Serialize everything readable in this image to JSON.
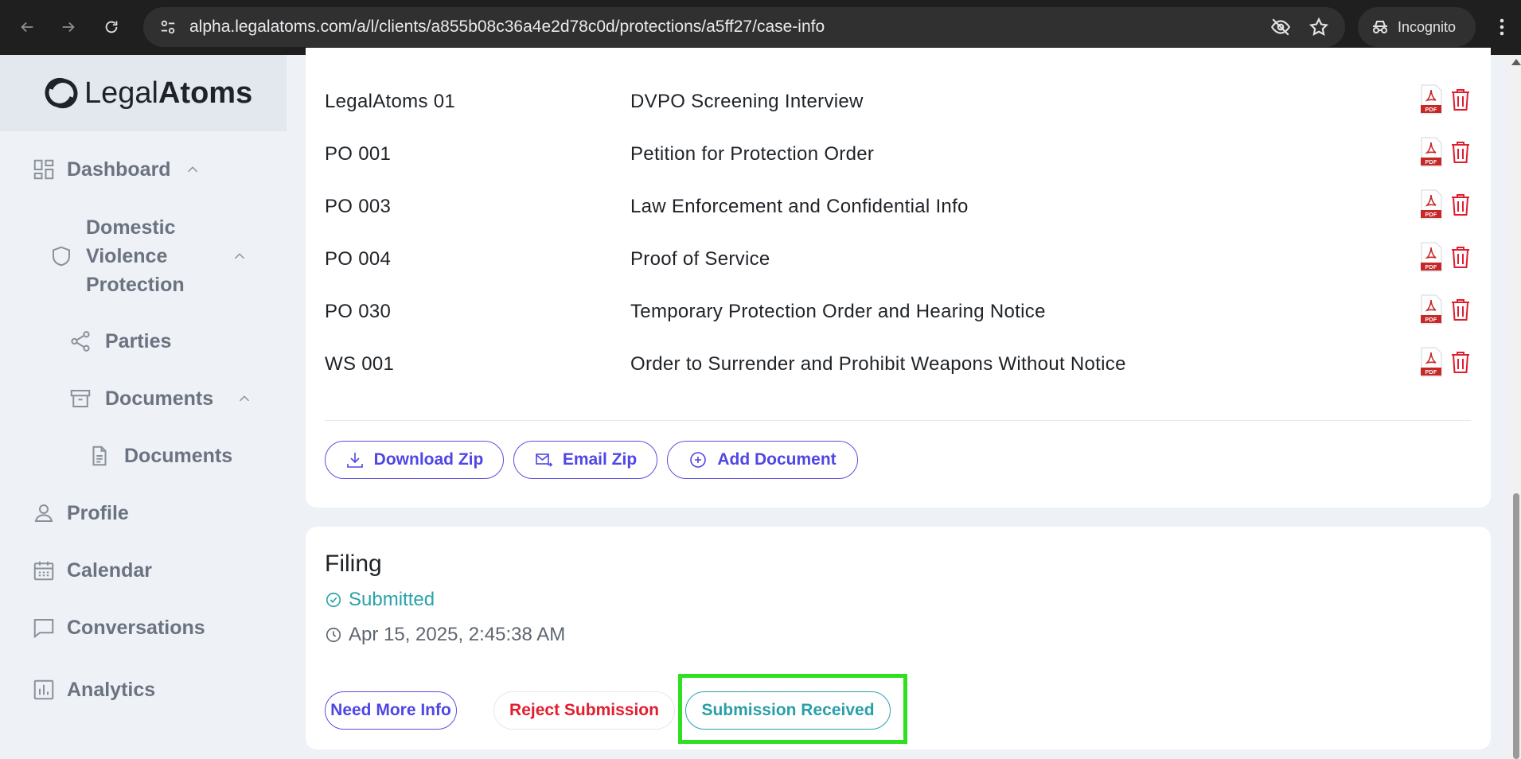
{
  "browser": {
    "url": "alpha.legalatoms.com/a/l/clients/a855b08c36a4e2d78c0d/protections/a5ff27/case-info",
    "incognito_label": "Incognito"
  },
  "brand": {
    "name_regular": "Legal",
    "name_bold": "Atoms"
  },
  "sidebar": {
    "dashboard": "Dashboard",
    "dvp_line1": "Domestic",
    "dvp_line2": "Violence",
    "dvp_line3": "Protection",
    "parties": "Parties",
    "documents_group": "Documents",
    "documents_item": "Documents",
    "profile": "Profile",
    "calendar": "Calendar",
    "conversations": "Conversations",
    "analytics": "Analytics"
  },
  "documents": {
    "rows": [
      {
        "code": "LegalAtoms 01",
        "name": "DVPO Screening Interview"
      },
      {
        "code": "PO 001",
        "name": "Petition for Protection Order"
      },
      {
        "code": "PO 003",
        "name": "Law Enforcement and Confidential Info"
      },
      {
        "code": "PO 004",
        "name": "Proof of Service"
      },
      {
        "code": "PO 030",
        "name": "Temporary Protection Order and Hearing Notice"
      },
      {
        "code": "WS 001",
        "name": "Order to Surrender and Prohibit Weapons Without Notice"
      }
    ],
    "download_zip": "Download Zip",
    "email_zip": "Email Zip",
    "add_document": "Add Document"
  },
  "filing": {
    "title": "Filing",
    "status": "Submitted",
    "timestamp": "Apr 15, 2025, 2:45:38 AM",
    "need_more_info": "Need More Info",
    "reject_submission": "Reject Submission",
    "submission_received": "Submission Received"
  },
  "colors": {
    "accent": "#4f46e5",
    "teal": "#2aa3ad",
    "danger": "#e11d2e",
    "highlight": "#2fe021"
  }
}
